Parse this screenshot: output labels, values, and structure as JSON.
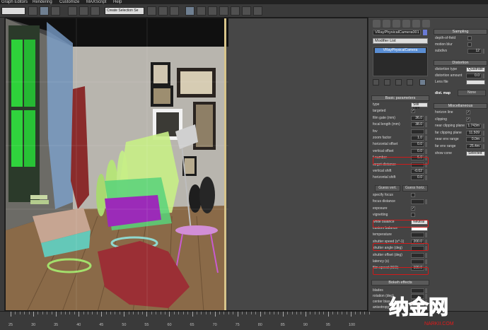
{
  "menu": [
    "Graph Editors",
    "Rendering",
    "Customize",
    "MAXScript",
    "Help"
  ],
  "toolbar": {
    "selection_set": "Create Selection Se",
    "left_dropdown": ""
  },
  "command_panel": {
    "object_name": "VRayPhysicalCamera001",
    "modifier_list": "Modifier List",
    "stack_item": "VRayPhysicalCamera",
    "basic": {
      "title": "Basic parameters",
      "rows": [
        {
          "label": "type",
          "value": "Still cam",
          "kind": "dropdown"
        },
        {
          "label": "targeted",
          "value": "✓",
          "kind": "check"
        },
        {
          "label": "film gate (mm)",
          "value": "36.0",
          "kind": "spin"
        },
        {
          "label": "focal length (mm)",
          "value": "38.0",
          "kind": "spin"
        },
        {
          "label": "fov",
          "value": "",
          "kind": "spin"
        },
        {
          "label": "zoom factor",
          "value": "1.0",
          "kind": "spin"
        },
        {
          "label": "horizontal offset",
          "value": "0.0",
          "kind": "spin"
        },
        {
          "label": "vertical offset",
          "value": "0.0",
          "kind": "spin"
        },
        {
          "label": "f-number",
          "value": "6.0",
          "kind": "spin"
        },
        {
          "label": "target distance",
          "value": "",
          "kind": "spin"
        },
        {
          "label": "vertical shift",
          "value": "-0.02",
          "kind": "spin"
        },
        {
          "label": "horizontal shift",
          "value": "0.0",
          "kind": "spin"
        }
      ],
      "guess_vert": "Guess vert.",
      "guess_horiz": "Guess horiz.",
      "rows2": [
        {
          "label": "specify focus",
          "value": "",
          "kind": "check"
        },
        {
          "label": "focus distance",
          "value": "",
          "kind": "spin"
        },
        {
          "label": "exposure",
          "value": "✓",
          "kind": "check"
        },
        {
          "label": "vignetting",
          "value": "",
          "kind": "check"
        },
        {
          "label": "white balance",
          "value": "Neutral",
          "kind": "dropdown"
        },
        {
          "label": "custom balance",
          "value": "",
          "kind": "color"
        },
        {
          "label": "temperature",
          "value": "",
          "kind": "spin"
        },
        {
          "label": "shutter speed (s^-1)",
          "value": "200.0",
          "kind": "spin"
        },
        {
          "label": "shutter angle (deg)",
          "value": "",
          "kind": "spin"
        },
        {
          "label": "shutter offset (deg)",
          "value": "",
          "kind": "spin"
        },
        {
          "label": "latency (s)",
          "value": "",
          "kind": "spin"
        },
        {
          "label": "film speed (ISO)",
          "value": "100.0",
          "kind": "spin"
        }
      ]
    },
    "bokeh": {
      "title": "Bokeh effects",
      "rows": [
        {
          "label": "blades",
          "value": ""
        },
        {
          "label": "rotation (deg)",
          "value": ""
        },
        {
          "label": "center bias",
          "value": ""
        },
        {
          "label": "anisotropy",
          "value": ""
        }
      ]
    },
    "sampling": {
      "title": "Sampling",
      "rows": [
        {
          "label": "depth-of-field",
          "value": "",
          "kind": "check"
        },
        {
          "label": "motion blur",
          "value": "",
          "kind": "check"
        },
        {
          "label": "subdivs",
          "value": "12",
          "kind": "spin"
        }
      ]
    },
    "distortion": {
      "title": "Distortion",
      "rows": [
        {
          "label": "distortion type",
          "value": "Quadratic",
          "kind": "dropdown"
        },
        {
          "label": "distortion amount",
          "value": "0.0",
          "kind": "spin"
        },
        {
          "label": "Lens file",
          "value": "",
          "kind": "field"
        }
      ],
      "dist_map": "dist. map",
      "none": "None"
    },
    "misc": {
      "title": "Miscellaneous",
      "rows": [
        {
          "label": "horizon line",
          "value": "✓",
          "kind": "check"
        },
        {
          "label": "clipping",
          "value": "✓",
          "kind": "check"
        },
        {
          "label": "near clipping plane",
          "value": "1.743m",
          "kind": "spin"
        },
        {
          "label": "far clipping plane",
          "value": "11.509",
          "kind": "spin"
        },
        {
          "label": "near env range",
          "value": "0.0m",
          "kind": "spin"
        },
        {
          "label": "far env range",
          "value": "25.4m",
          "kind": "spin"
        },
        {
          "label": "show cone",
          "value": "Selected",
          "kind": "dropdown"
        }
      ]
    }
  },
  "timeline": {
    "labels": [
      "25",
      "30",
      "35",
      "40",
      "45",
      "50",
      "55",
      "60",
      "65",
      "70",
      "75",
      "80",
      "85",
      "90",
      "95",
      "100"
    ]
  },
  "watermark": {
    "text": "纳金网",
    "sub": "NARKII.COM"
  },
  "colors": {
    "highlight": "#d11a1a",
    "safe_frame": "#d7c48a",
    "watermark": "#e11b1b"
  }
}
